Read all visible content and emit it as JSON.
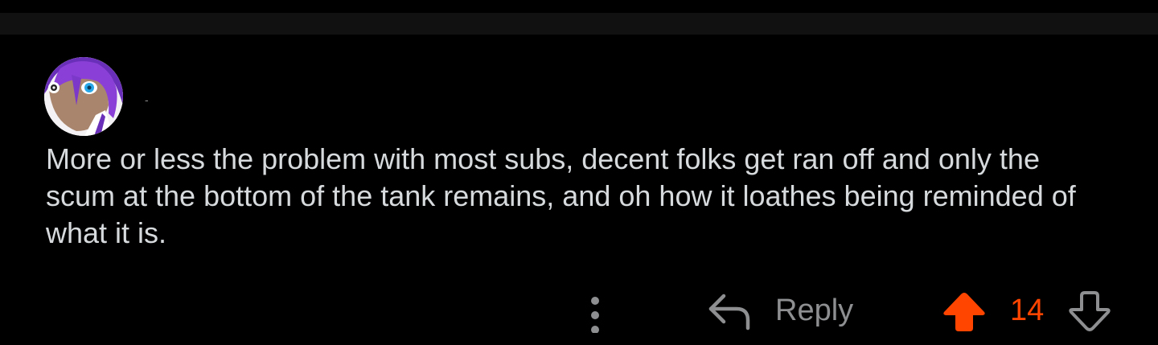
{
  "comment": {
    "author": "-",
    "body": "More or less the problem with most subs, decent folks get ran off and only the scum at the bottom of the tank remains, and oh how it loathes being reminded of what it is."
  },
  "actions": {
    "reply_label": "Reply",
    "score": "14",
    "upvote_state": "upvoted"
  },
  "colors": {
    "background": "#000000",
    "divider": "#111112",
    "text": "#d7dadc",
    "muted": "#8d8f91",
    "upvote_accent": "#ff4500"
  },
  "icons": {
    "more": "vertical-ellipsis-icon",
    "reply": "reply-arrow-icon",
    "upvote": "upvote-arrow-icon",
    "downvote": "downvote-arrow-icon"
  }
}
